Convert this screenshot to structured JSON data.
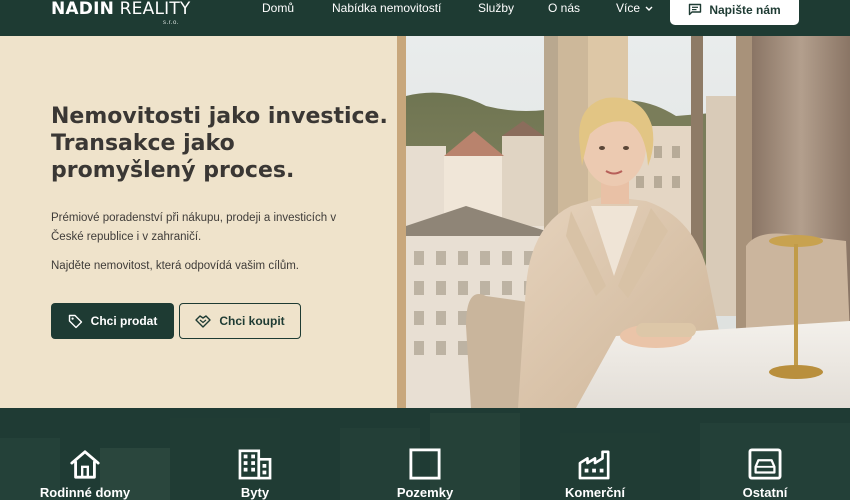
{
  "header": {
    "logo_main_bold": "NADIN",
    "logo_main_light": " REALITY",
    "logo_sub": "s.r.o.",
    "nav": [
      "Domů",
      "Nabídka nemovitostí",
      "Služby",
      "O nás",
      "Více"
    ],
    "cta": "Napište nám"
  },
  "hero": {
    "title_lines": [
      "Nemovitosti jako investice.",
      "Transakce jako",
      "promyšlený proces."
    ],
    "paragraph_lines": [
      "Prémiové poradenství při nákupu, prodeji a investicích v",
      "České republice i v zahraničí."
    ],
    "paragraph2": "Najděte nemovitost, která odpovídá vašim cílům.",
    "btn_sell": "Chci prodat",
    "btn_buy": "Chci koupit"
  },
  "categories": [
    {
      "label": "Rodinné domy",
      "icon": "house-icon"
    },
    {
      "label": "Byty",
      "icon": "building-icon"
    },
    {
      "label": "Pozemky",
      "icon": "square-plot-icon"
    },
    {
      "label": "Komerční",
      "icon": "factory-icon"
    },
    {
      "label": "Ostatní",
      "icon": "garage-icon"
    }
  ],
  "colors": {
    "brand_dark": "#1e3b33",
    "hero_bg": "#efe3cb",
    "accent_gold": "#c8a77c",
    "text_dark": "#3a3734"
  }
}
